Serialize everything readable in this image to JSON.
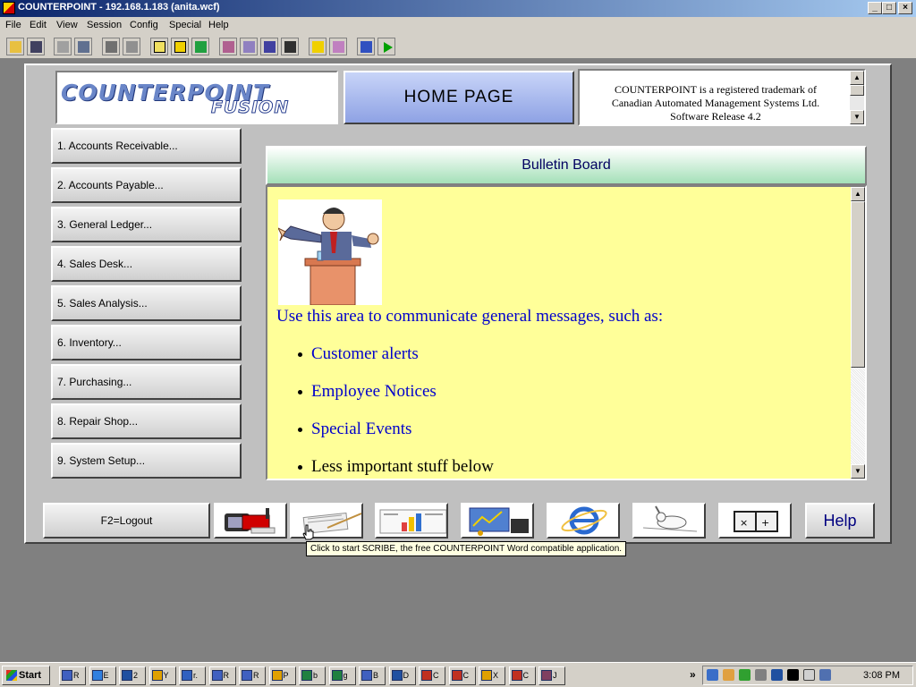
{
  "window": {
    "title": "COUNTERPOINT -  192.168.1.183 (anita.wcf)",
    "min": "_",
    "max": "□",
    "close": "×"
  },
  "menu": [
    {
      "label": "File"
    },
    {
      "label": "Edit"
    },
    {
      "label": "View"
    },
    {
      "label": "Session"
    },
    {
      "label": "Config"
    },
    {
      "label": "Special"
    },
    {
      "label": "Help"
    }
  ],
  "header": {
    "logo_main": "COUNTERPOINT",
    "logo_sub": "FUSION",
    "home_title": "HOME  PAGE",
    "trademark": [
      "COUNTERPOINT is a registered trademark of",
      "Canadian Automated Management Systems Ltd.",
      "Software Release 4.2"
    ]
  },
  "nav": [
    {
      "label": "1. Accounts Receivable..."
    },
    {
      "label": "2. Accounts Payable..."
    },
    {
      "label": "3. General Ledger..."
    },
    {
      "label": "4. Sales Desk..."
    },
    {
      "label": "5. Sales Analysis..."
    },
    {
      "label": "6. Inventory..."
    },
    {
      "label": "7. Purchasing..."
    },
    {
      "label": "8. Repair Shop..."
    },
    {
      "label": "9. System Setup..."
    }
  ],
  "bulletin": {
    "title": "Bulletin Board",
    "intro": "Use this area to communicate general messages, such as:",
    "items": [
      "Customer alerts",
      "Employee Notices",
      "Special Events",
      "Less important stuff below"
    ]
  },
  "bottom": {
    "logout": "F2=Logout",
    "help": "Help",
    "tooltip": "Click to start SCRIBE, the free COUNTERPOINT Word compatible application."
  },
  "taskbar": {
    "start": "Start",
    "tasks": [
      "R",
      "E",
      "2",
      "Y",
      "r.",
      "R",
      "R",
      "P",
      "b",
      "g",
      "B",
      "D",
      "C",
      "C",
      "X",
      "C",
      "J"
    ],
    "chevron": "»",
    "clock": "3:08 PM"
  }
}
